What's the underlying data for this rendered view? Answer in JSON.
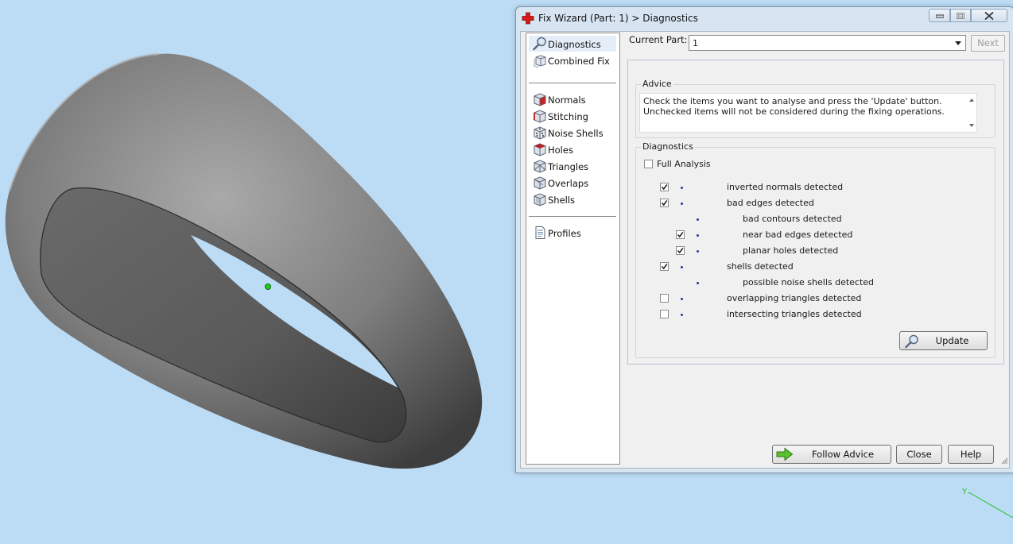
{
  "window": {
    "title": "Fix Wizard (Part: 1) > Diagnostics"
  },
  "nav": {
    "items": [
      {
        "label": "Diagnostics",
        "icon": "magnifier-icon",
        "selected": true
      },
      {
        "label": "Combined Fix",
        "icon": "cube-stack-icon",
        "selected": false
      },
      {
        "label": "Normals",
        "icon": "cube-red-face-icon",
        "selected": false
      },
      {
        "label": "Stitching",
        "icon": "cube-edge-icon",
        "selected": false
      },
      {
        "label": "Noise Shells",
        "icon": "dice-icon",
        "selected": false
      },
      {
        "label": "Holes",
        "icon": "cube-hole-icon",
        "selected": false
      },
      {
        "label": "Triangles",
        "icon": "triangle-mesh-icon",
        "selected": false
      },
      {
        "label": "Overlaps",
        "icon": "overlap-cube-icon",
        "selected": false
      },
      {
        "label": "Shells",
        "icon": "cube-shell-icon",
        "selected": false
      },
      {
        "label": "Profiles",
        "icon": "document-icon",
        "selected": false
      }
    ]
  },
  "current_part": {
    "label": "Current Part:",
    "value": "1",
    "next_label": "Next"
  },
  "advice": {
    "title": "Advice",
    "text": "Check the items you want to analyse and press the 'Update' button. Unchecked items will not be considered during the fixing operations."
  },
  "diagnostics": {
    "title": "Diagnostics",
    "full_analysis_label": "Full Analysis",
    "full_analysis_checked": false,
    "rows": [
      {
        "label": "inverted normals detected",
        "checked": true,
        "has_checkbox": true,
        "indent": 0
      },
      {
        "label": "bad edges detected",
        "checked": true,
        "has_checkbox": true,
        "indent": 0
      },
      {
        "label": "bad contours detected",
        "checked": false,
        "has_checkbox": false,
        "indent": 1
      },
      {
        "label": "near bad edges detected",
        "checked": true,
        "has_checkbox": true,
        "indent": 1
      },
      {
        "label": "planar holes detected",
        "checked": true,
        "has_checkbox": true,
        "indent": 1
      },
      {
        "label": "shells detected",
        "checked": true,
        "has_checkbox": true,
        "indent": 0
      },
      {
        "label": "possible noise shells detected",
        "checked": false,
        "has_checkbox": false,
        "indent": 1
      },
      {
        "label": "overlapping triangles detected",
        "checked": false,
        "has_checkbox": true,
        "indent": 0
      },
      {
        "label": "intersecting triangles detected",
        "checked": false,
        "has_checkbox": true,
        "indent": 0
      }
    ],
    "update_label": "Update"
  },
  "footer": {
    "follow_advice_label": "Follow Advice",
    "close_label": "Close",
    "help_label": "Help"
  },
  "viewport": {
    "axis_label": "Y",
    "background_color": "#bcdcf6",
    "model_color": "#7d7d7d"
  }
}
